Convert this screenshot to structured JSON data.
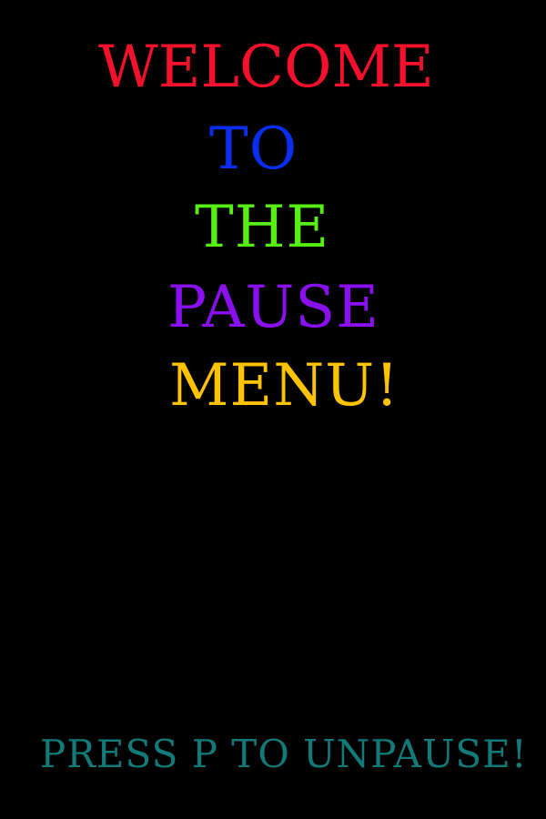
{
  "pause_menu": {
    "title_words": [
      {
        "text": "WELCOME",
        "color": "#f5102c"
      },
      {
        "text": "TO",
        "color": "#0a2ef0"
      },
      {
        "text": "THE",
        "color": "#57ee12"
      },
      {
        "text": "PAUSE",
        "color": "#8a10f2"
      },
      {
        "text": "MENU!",
        "color": "#ffc300"
      }
    ],
    "hint": {
      "text": "PRESS P TO UNPAUSE!",
      "color": "#137a7a"
    },
    "background_color": "#000000"
  }
}
